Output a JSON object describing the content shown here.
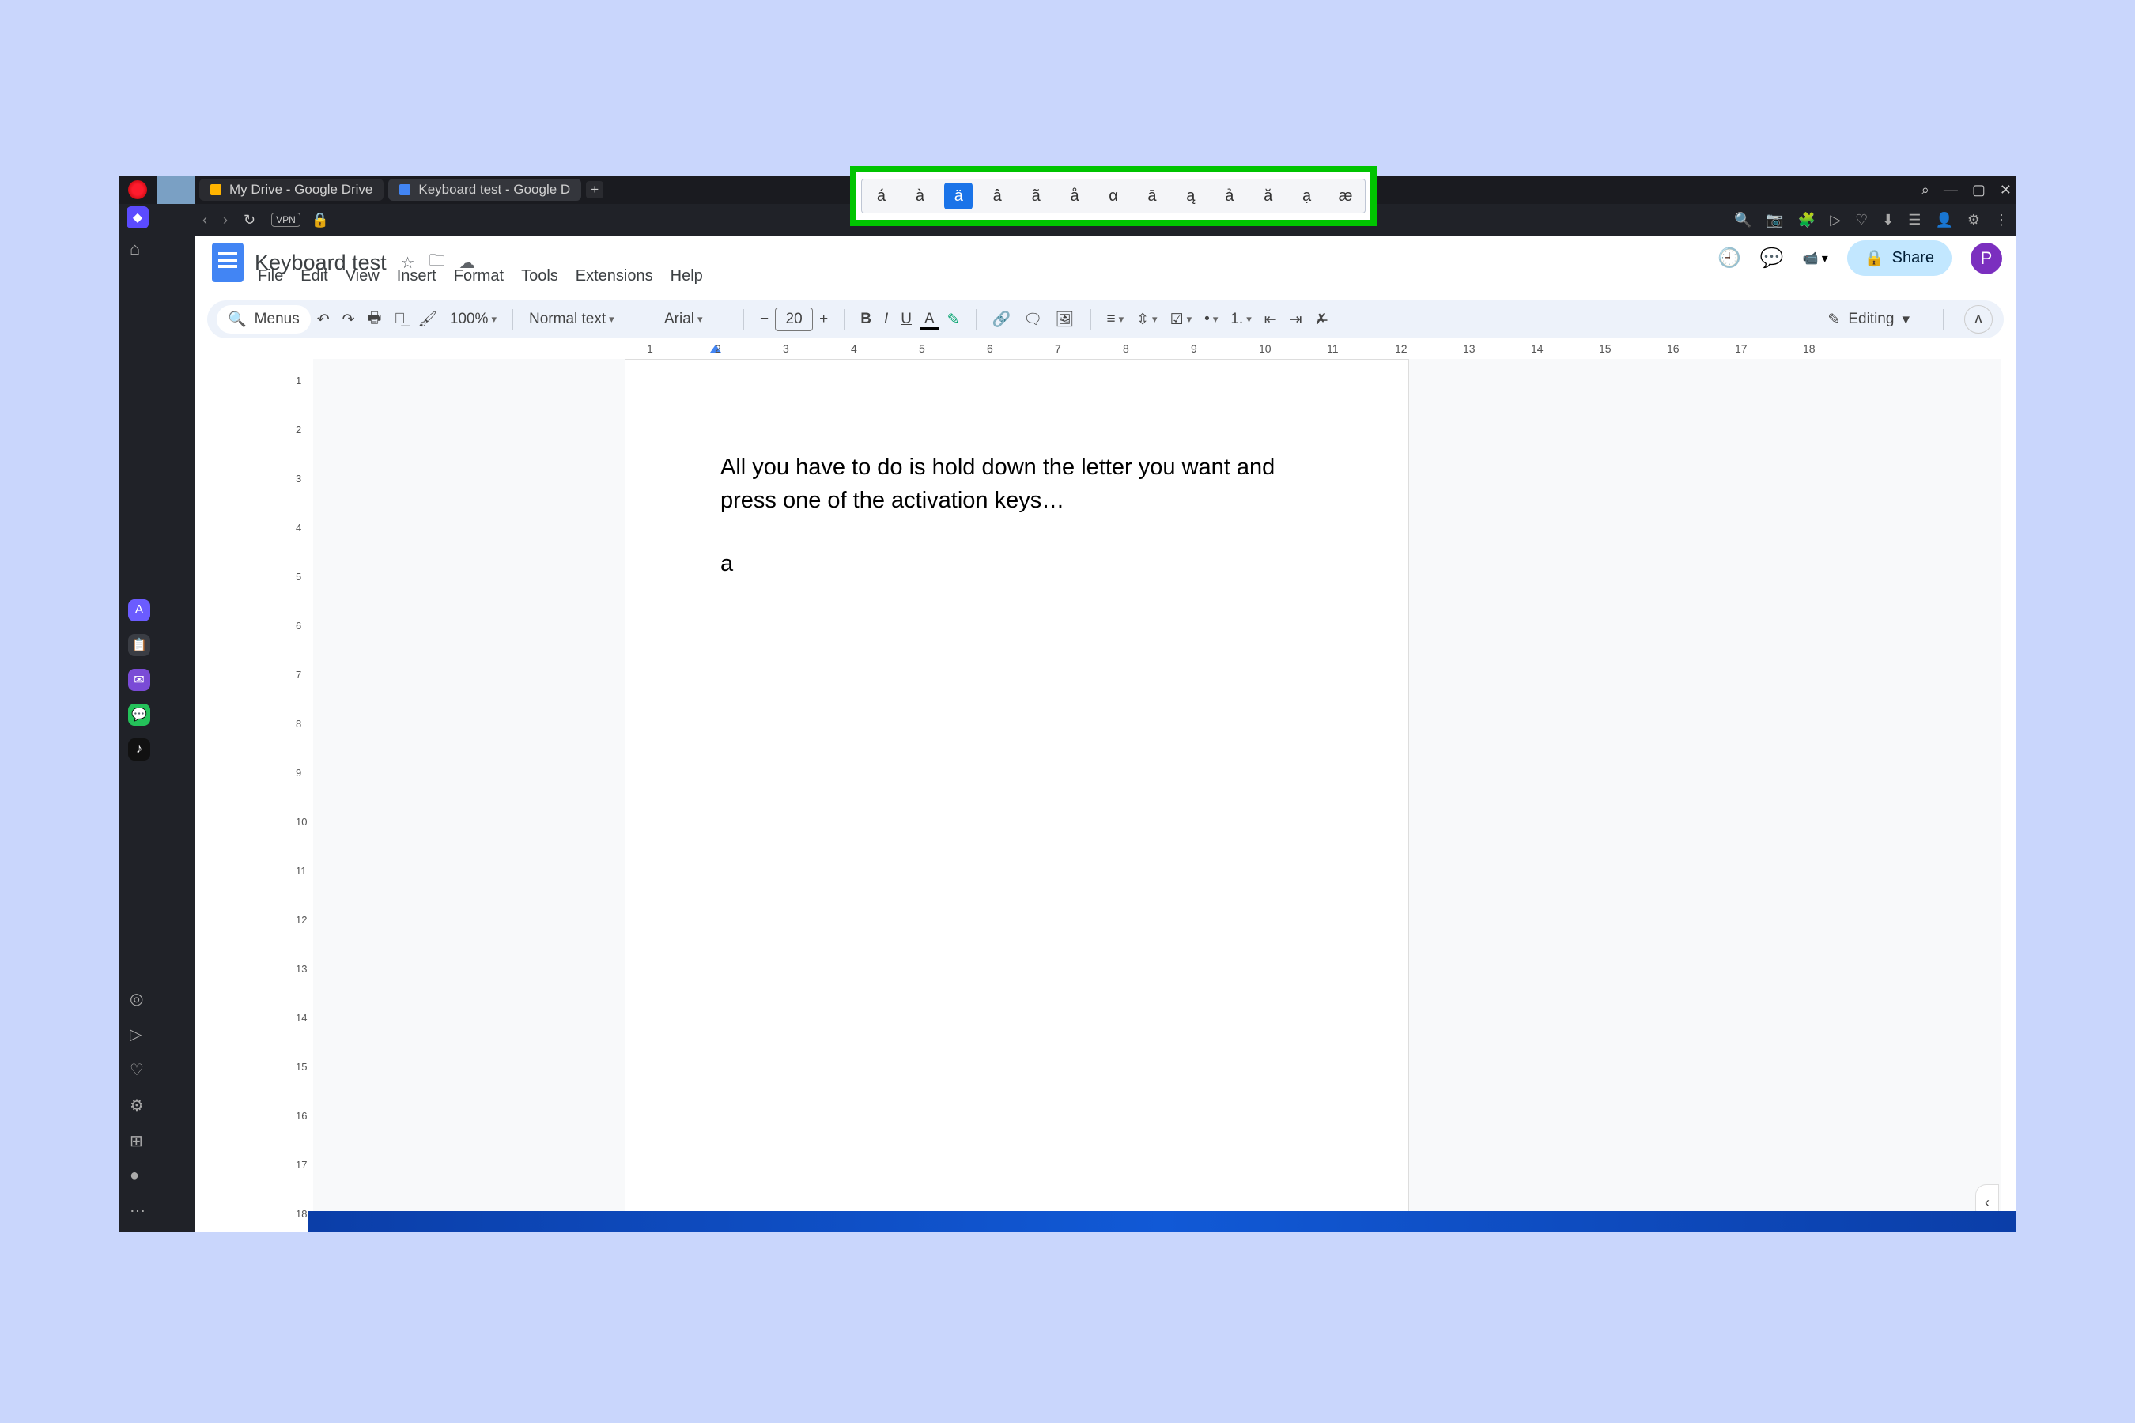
{
  "accentPopup": {
    "chars": [
      "á",
      "à",
      "ä",
      "â",
      "ã",
      "å",
      "α",
      "ā",
      "ą",
      "ả",
      "ă",
      "ạ",
      "æ"
    ],
    "selected": 2
  },
  "browser": {
    "tabs": [
      {
        "label": "My Drive - Google Drive",
        "favColor": "#ffb400"
      },
      {
        "label": "Keyboard test - Google D",
        "favColor": "#4285f4"
      }
    ],
    "newTab": "+",
    "winSearch": "⌕",
    "winMin": "—",
    "winMax": "▢",
    "winClose": "✕",
    "navBack": "‹",
    "navFwd": "›",
    "reload": "↻",
    "vpn": "VPN",
    "lock": "🔒",
    "rightIcons": [
      "🔍",
      "📷",
      "🧩",
      "▷",
      "♡",
      "⬇",
      "☰",
      "👤",
      "⚙",
      "⋮"
    ]
  },
  "operaSide": {
    "home": "⌂",
    "apps": [
      {
        "bg": "#6b5cff",
        "glyph": "A"
      },
      {
        "bg": "#3a3d44",
        "glyph": "📋"
      },
      {
        "bg": "#7a4bd6",
        "glyph": "✉"
      },
      {
        "bg": "#24c25a",
        "glyph": "💬"
      },
      {
        "bg": "#111",
        "glyph": "♪"
      }
    ],
    "bottom": [
      "◎",
      "▷",
      "♡",
      "⚙",
      "⊞",
      "●",
      "⋯"
    ]
  },
  "docs": {
    "title": "Keyboard test",
    "titleIcons": {
      "star": "☆",
      "move": "🗀",
      "cloud": "☁"
    },
    "menus": [
      "File",
      "Edit",
      "View",
      "Insert",
      "Format",
      "Tools",
      "Extensions",
      "Help"
    ],
    "history": "🕘",
    "comments": "💬",
    "meet": "📹",
    "meetDrop": "▾",
    "share": {
      "lock": "🔒",
      "label": "Share"
    },
    "avatar": "P",
    "toolbar": {
      "searchIcon": "🔍",
      "menus": "Menus",
      "undo": "↶",
      "redo": "↷",
      "print": "🖶",
      "spell": "Ａ̲",
      "paint": "🖌",
      "zoom": "100%",
      "style": "Normal text",
      "font": "Arial",
      "minus": "−",
      "size": "20",
      "plus": "+",
      "bold": "B",
      "italic": "I",
      "under": "U",
      "textA": "A",
      "highlighter": "✎",
      "link": "🔗",
      "comment": "🗨",
      "image": "🖼",
      "align": "≡",
      "spacing": "⇳",
      "checklist": "☑",
      "bullets": "•",
      "numbers": "1.",
      "outdent": "⇤",
      "indent": "⇥",
      "clear": "✗̶",
      "editPencil": "✎",
      "editLabel": "Editing",
      "editDrop": "▾",
      "collapse": "ʌ"
    },
    "ruler": {
      "left": "↤",
      "nums": [
        "1",
        "2",
        "3",
        "4",
        "5",
        "6",
        "7",
        "8",
        "9",
        "10",
        "11",
        "12",
        "13",
        "14",
        "15",
        "16",
        "17",
        "18"
      ],
      "right": "↦"
    },
    "vruler": [
      "1",
      "2",
      "3",
      "4",
      "5",
      "6",
      "7",
      "8",
      "9",
      "10",
      "11",
      "12",
      "13",
      "14",
      "15",
      "16",
      "17",
      "18"
    ],
    "outlineIcon": "≔",
    "body": {
      "p1": "All you have to do is hold down the letter you want and press one of the activation keys…",
      "p2": "a"
    },
    "expand": "‹"
  }
}
